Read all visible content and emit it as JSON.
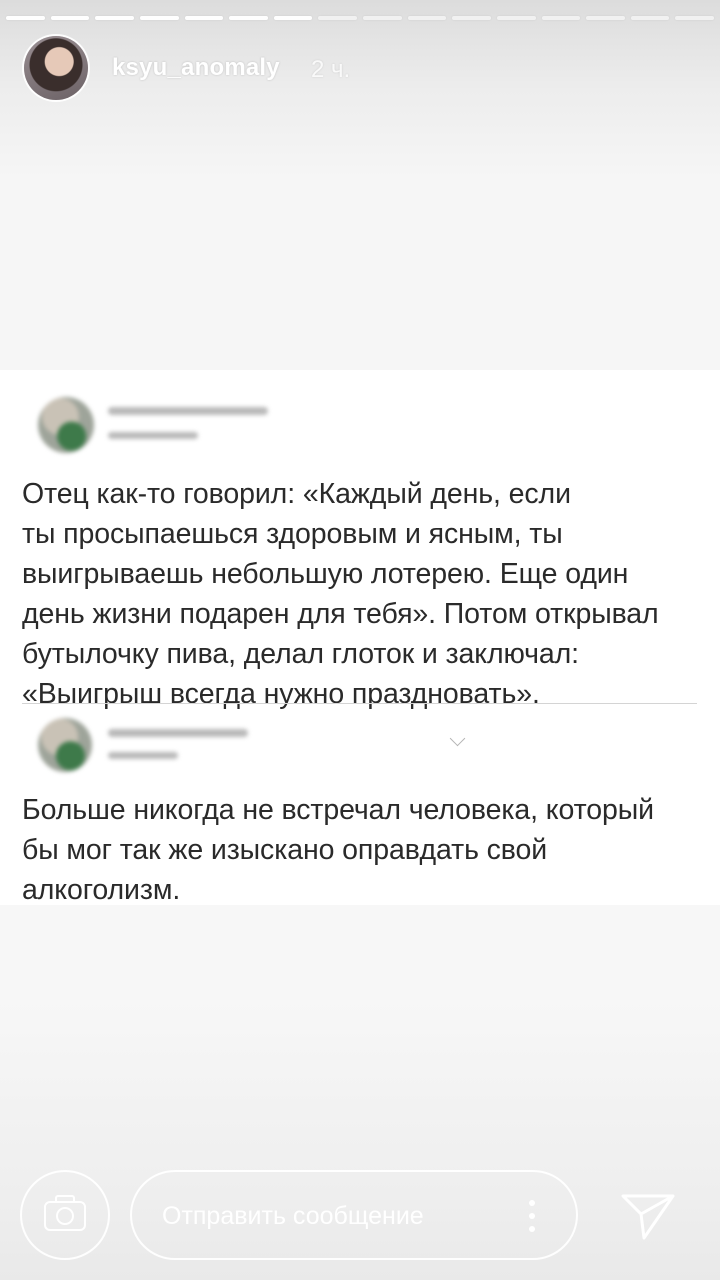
{
  "story": {
    "segments_total": 16,
    "segments_viewed": 7
  },
  "header": {
    "username": "ksyu_anomaly",
    "time": "2 ч."
  },
  "post": {
    "tweet1_text": "Отец как-то говорил: «Каждый день, если\nты просыпаешься здоровым и ясным, ты\nвыигрываешь небольшую лотерею. Еще один\nдень жизни подарен для тебя». Потом открывал\nбутылочку пива, делал глоток и заключал:\n«Выигрыш всегда нужно праздновать».",
    "tweet2_text": "Больше никогда не встречал человека, который\nбы мог так же изыскано оправдать свой\nалкоголизм."
  },
  "bottom_bar": {
    "message_placeholder": "Отправить сообщение"
  },
  "icons": {
    "camera": "camera-icon",
    "more": "more-vertical-icon",
    "send": "paper-plane-icon"
  }
}
